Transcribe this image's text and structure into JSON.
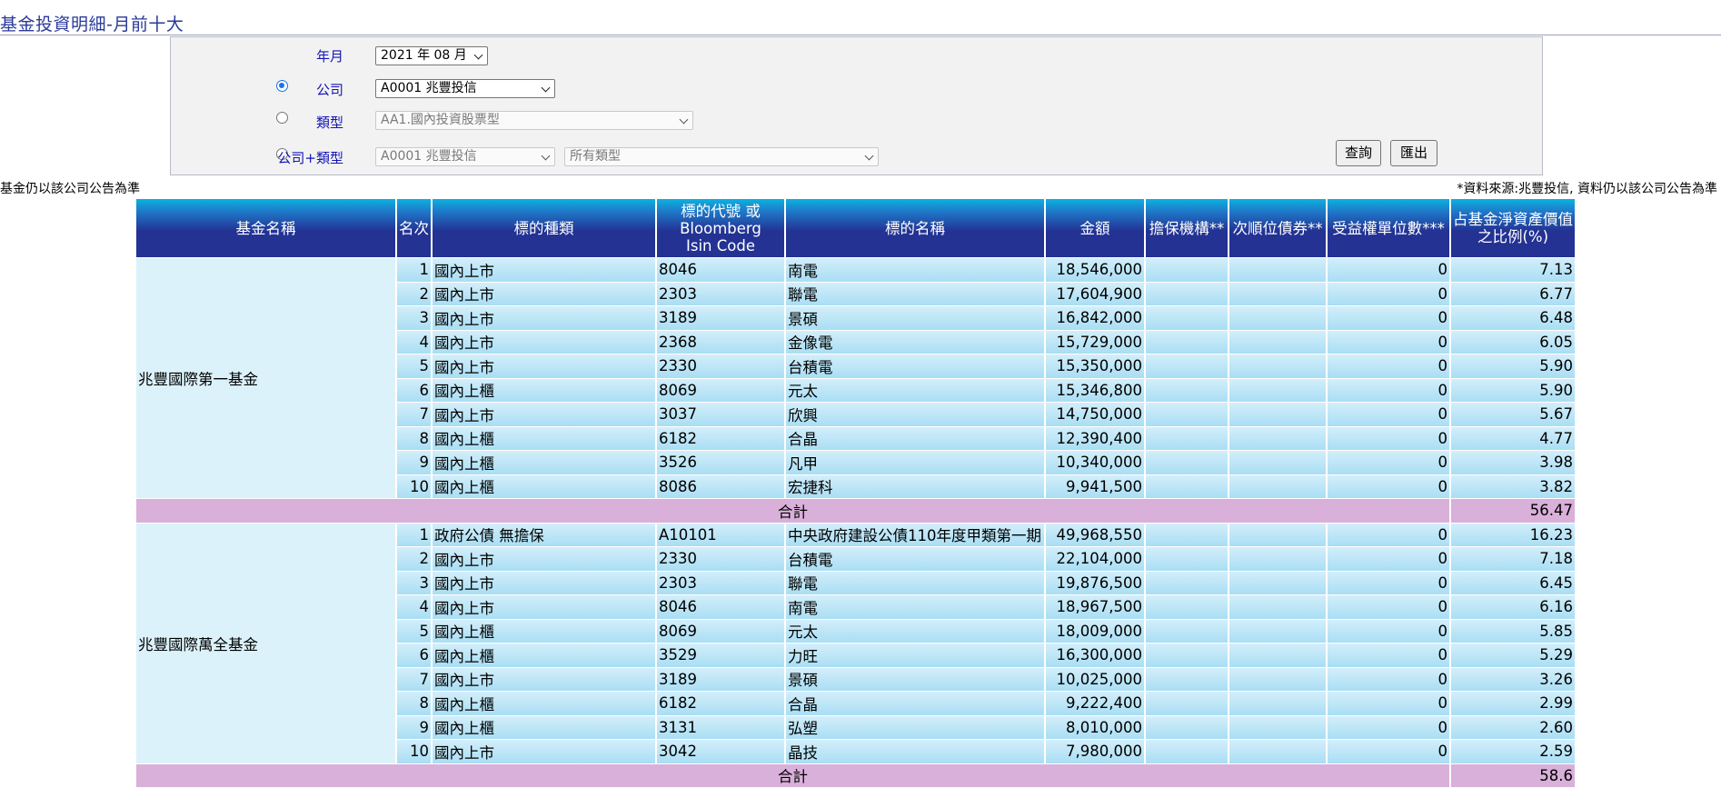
{
  "page": {
    "title": "基金投資明細-月前十大"
  },
  "query": {
    "month_label": "年月",
    "month_value": "2021 年 08 月",
    "company_label": "公司",
    "company_value": "A0001 兆豐投信",
    "type_label": "類型",
    "type_value": "AA1.國內投資股票型",
    "company_type_label": "公司+類型",
    "company_type_company_value": "A0001 兆豐投信",
    "company_type_type_value": "所有類型",
    "selected_mode": "company",
    "query_button": "查詢",
    "export_button": "匯出"
  },
  "notes": {
    "left": "基金仍以該公司公告為準",
    "right": "*資料來源:兆豐投信, 資料仍以該公司公告為準"
  },
  "table": {
    "headers": {
      "fund_name": "基金名稱",
      "rank": "名次",
      "asset_type": "標的種類",
      "code_line1": "標的代號 或",
      "code_line2": "Bloomberg",
      "code_line3": "Isin Code",
      "asset_name": "標的名稱",
      "amount": "金額",
      "guarantor": "擔保機構**",
      "subordinated": "次順位債券**",
      "units": "受益權單位數***",
      "ratio_line1": "占基金淨資產價值",
      "ratio_line2": "之比例(%)"
    },
    "subtotal_label": "合計",
    "funds": [
      {
        "name": "兆豐國際第一基金",
        "rows": [
          {
            "rank": "1",
            "type": "國內上市",
            "code": "8046",
            "asset": "南電",
            "amount": "18,546,000",
            "guarantor": "",
            "subordinated": "",
            "units": "0",
            "ratio": "7.13"
          },
          {
            "rank": "2",
            "type": "國內上市",
            "code": "2303",
            "asset": "聯電",
            "amount": "17,604,900",
            "guarantor": "",
            "subordinated": "",
            "units": "0",
            "ratio": "6.77"
          },
          {
            "rank": "3",
            "type": "國內上市",
            "code": "3189",
            "asset": "景碩",
            "amount": "16,842,000",
            "guarantor": "",
            "subordinated": "",
            "units": "0",
            "ratio": "6.48"
          },
          {
            "rank": "4",
            "type": "國內上市",
            "code": "2368",
            "asset": "金像電",
            "amount": "15,729,000",
            "guarantor": "",
            "subordinated": "",
            "units": "0",
            "ratio": "6.05"
          },
          {
            "rank": "5",
            "type": "國內上市",
            "code": "2330",
            "asset": "台積電",
            "amount": "15,350,000",
            "guarantor": "",
            "subordinated": "",
            "units": "0",
            "ratio": "5.90"
          },
          {
            "rank": "6",
            "type": "國內上櫃",
            "code": "8069",
            "asset": "元太",
            "amount": "15,346,800",
            "guarantor": "",
            "subordinated": "",
            "units": "0",
            "ratio": "5.90"
          },
          {
            "rank": "7",
            "type": "國內上市",
            "code": "3037",
            "asset": "欣興",
            "amount": "14,750,000",
            "guarantor": "",
            "subordinated": "",
            "units": "0",
            "ratio": "5.67"
          },
          {
            "rank": "8",
            "type": "國內上櫃",
            "code": "6182",
            "asset": "合晶",
            "amount": "12,390,400",
            "guarantor": "",
            "subordinated": "",
            "units": "0",
            "ratio": "4.77"
          },
          {
            "rank": "9",
            "type": "國內上櫃",
            "code": "3526",
            "asset": "凡甲",
            "amount": "10,340,000",
            "guarantor": "",
            "subordinated": "",
            "units": "0",
            "ratio": "3.98"
          },
          {
            "rank": "10",
            "type": "國內上櫃",
            "code": "8086",
            "asset": "宏捷科",
            "amount": "9,941,500",
            "guarantor": "",
            "subordinated": "",
            "units": "0",
            "ratio": "3.82"
          }
        ],
        "total": "56.47"
      },
      {
        "name": "兆豐國際萬全基金",
        "rows": [
          {
            "rank": "1",
            "type": "政府公債 無擔保",
            "code": "A10101",
            "asset": "中央政府建設公債110年度甲類第一期",
            "amount": "49,968,550",
            "guarantor": "",
            "subordinated": "",
            "units": "0",
            "ratio": "16.23"
          },
          {
            "rank": "2",
            "type": "國內上市",
            "code": "2330",
            "asset": "台積電",
            "amount": "22,104,000",
            "guarantor": "",
            "subordinated": "",
            "units": "0",
            "ratio": "7.18"
          },
          {
            "rank": "3",
            "type": "國內上市",
            "code": "2303",
            "asset": "聯電",
            "amount": "19,876,500",
            "guarantor": "",
            "subordinated": "",
            "units": "0",
            "ratio": "6.45"
          },
          {
            "rank": "4",
            "type": "國內上市",
            "code": "8046",
            "asset": "南電",
            "amount": "18,967,500",
            "guarantor": "",
            "subordinated": "",
            "units": "0",
            "ratio": "6.16"
          },
          {
            "rank": "5",
            "type": "國內上櫃",
            "code": "8069",
            "asset": "元太",
            "amount": "18,009,000",
            "guarantor": "",
            "subordinated": "",
            "units": "0",
            "ratio": "5.85"
          },
          {
            "rank": "6",
            "type": "國內上櫃",
            "code": "3529",
            "asset": "力旺",
            "amount": "16,300,000",
            "guarantor": "",
            "subordinated": "",
            "units": "0",
            "ratio": "5.29"
          },
          {
            "rank": "7",
            "type": "國內上市",
            "code": "3189",
            "asset": "景碩",
            "amount": "10,025,000",
            "guarantor": "",
            "subordinated": "",
            "units": "0",
            "ratio": "3.26"
          },
          {
            "rank": "8",
            "type": "國內上櫃",
            "code": "6182",
            "asset": "合晶",
            "amount": "9,222,400",
            "guarantor": "",
            "subordinated": "",
            "units": "0",
            "ratio": "2.99"
          },
          {
            "rank": "9",
            "type": "國內上櫃",
            "code": "3131",
            "asset": "弘塑",
            "amount": "8,010,000",
            "guarantor": "",
            "subordinated": "",
            "units": "0",
            "ratio": "2.60"
          },
          {
            "rank": "10",
            "type": "國內上市",
            "code": "3042",
            "asset": "晶技",
            "amount": "7,980,000",
            "guarantor": "",
            "subordinated": "",
            "units": "0",
            "ratio": "2.59"
          }
        ],
        "total": "58.6"
      }
    ]
  }
}
